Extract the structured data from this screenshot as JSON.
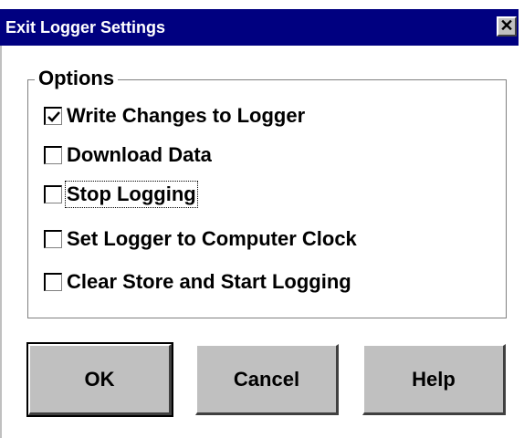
{
  "window": {
    "title": "Exit Logger Settings",
    "close_glyph": "✕"
  },
  "options_group": {
    "legend": "Options",
    "items": [
      {
        "label": "Write Changes to Logger",
        "checked": true
      },
      {
        "label": "Download Data",
        "checked": false
      },
      {
        "label": "Stop Logging",
        "checked": false,
        "focused": true
      },
      {
        "label": "Set Logger to Computer Clock",
        "checked": false
      },
      {
        "label": "Clear Store and Start Logging",
        "checked": false
      }
    ]
  },
  "buttons": {
    "ok_label": "OK",
    "cancel_label": "Cancel",
    "help_label": "Help"
  },
  "colors": {
    "titlebar": "#000080",
    "face": "#c0c0c0"
  }
}
